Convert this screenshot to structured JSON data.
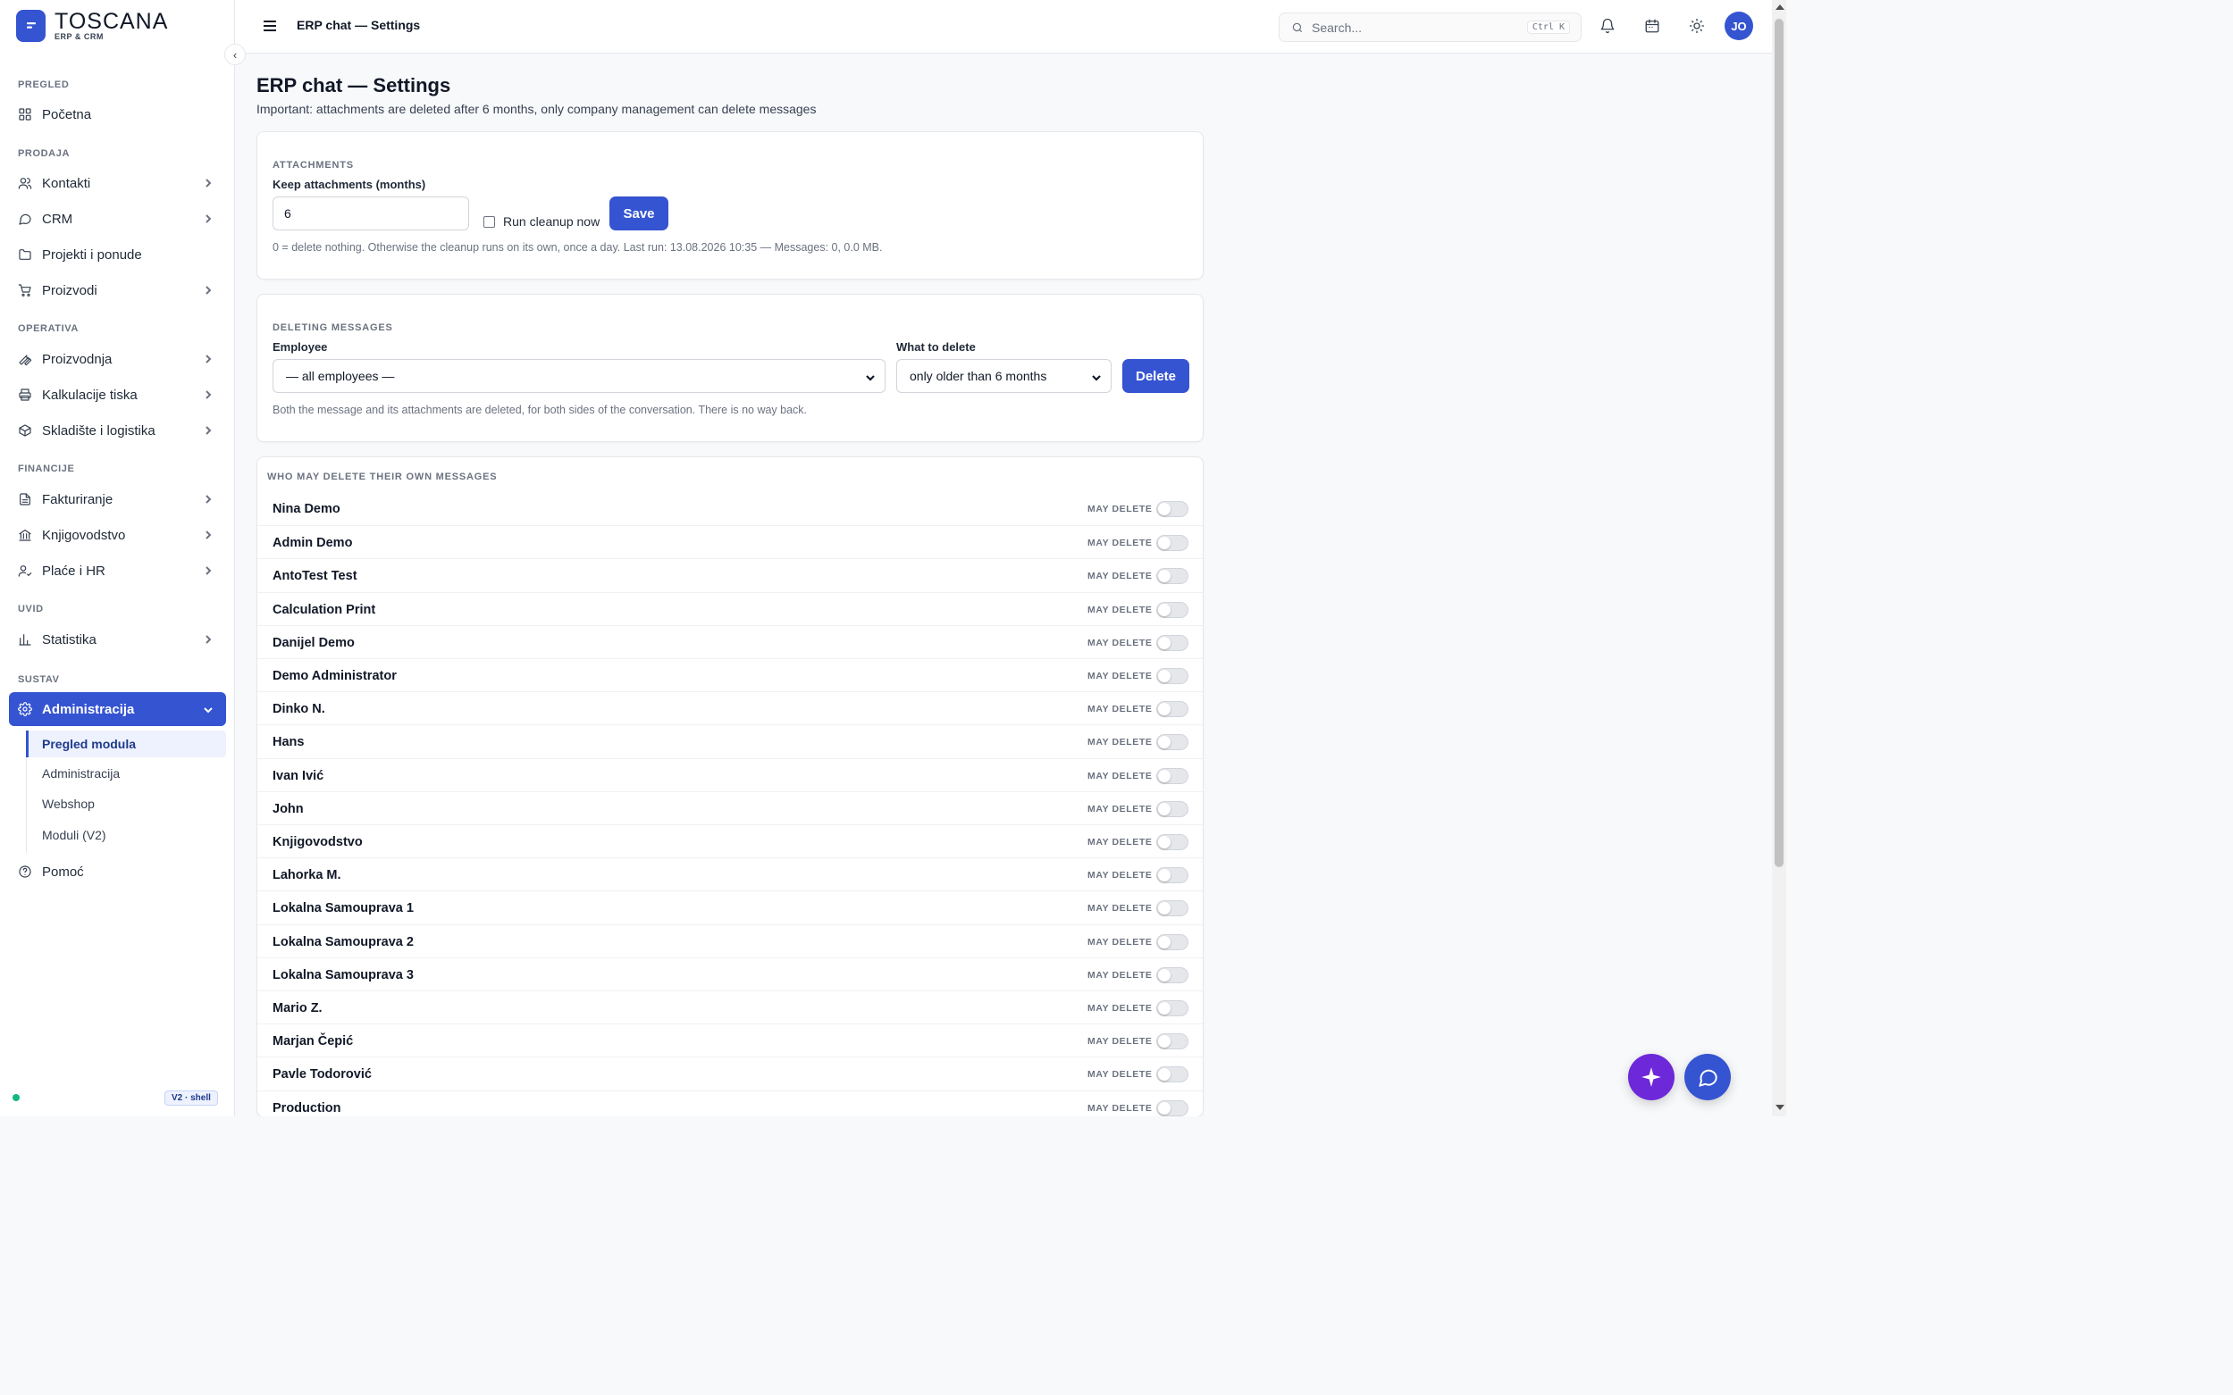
{
  "brand": {
    "name": "TOSCANA",
    "subtitle": "ERP & CRM"
  },
  "sidebar": {
    "sections": [
      {
        "label": "PREGLED"
      },
      {
        "label": "PRODAJA"
      },
      {
        "label": "OPERATIVA"
      },
      {
        "label": "FINANCIJE"
      },
      {
        "label": "UVID"
      },
      {
        "label": "SUSTAV"
      }
    ],
    "items": [
      {
        "label": "Početna",
        "icon": "dashboard-icon"
      },
      {
        "label": "Kontakti",
        "icon": "users-icon"
      },
      {
        "label": "CRM",
        "icon": "chat-icon"
      },
      {
        "label": "Projekti i ponude",
        "icon": "folder-icon"
      },
      {
        "label": "Proizvodi",
        "icon": "cart-icon"
      },
      {
        "label": "Proizvodnja",
        "icon": "wrench-icon"
      },
      {
        "label": "Kalkulacije tiska",
        "icon": "printer-icon"
      },
      {
        "label": "Skladište i logistika",
        "icon": "box-icon"
      },
      {
        "label": "Fakturiranje",
        "icon": "invoice-icon"
      },
      {
        "label": "Knjigovodstvo",
        "icon": "bank-icon"
      },
      {
        "label": "Plaće i HR",
        "icon": "user-check-icon"
      },
      {
        "label": "Statistika",
        "icon": "bar-chart-icon"
      },
      {
        "label": "Administracija",
        "icon": "gear-icon"
      },
      {
        "label": "Pomoć",
        "icon": "help-icon"
      }
    ],
    "subitems": [
      {
        "label": "Pregled modula"
      },
      {
        "label": "Administracija"
      },
      {
        "label": "Webshop"
      },
      {
        "label": "Moduli (V2)"
      }
    ],
    "version_badge": "V2 · shell"
  },
  "topbar": {
    "breadcrumb": "ERP chat — Settings",
    "search_placeholder": "Search...",
    "search_shortcut": "Ctrl K",
    "avatar_initials": "JO"
  },
  "page": {
    "title": "ERP chat — Settings",
    "subtitle": "Important: attachments are deleted after 6 months, only company management can delete messages"
  },
  "attachments": {
    "heading": "ATTACHMENTS",
    "keep_label": "Keep attachments (months)",
    "keep_value": "6",
    "cleanup_label": "Run cleanup now",
    "save_label": "Save",
    "hint": "0 = delete nothing. Otherwise the cleanup runs on its own, once a day. Last run: 13.08.2026 10:35 — Messages: 0, 0.0 MB."
  },
  "deleting": {
    "heading": "DELETING MESSAGES",
    "employee_label": "Employee",
    "employee_value": "— all employees —",
    "what_label": "What to delete",
    "what_value": "only older than 6 months",
    "delete_label": "Delete",
    "hint": "Both the message and its attachments are deleted, for both sides of the conversation. There is no way back."
  },
  "permissions": {
    "heading": "WHO MAY DELETE THEIR OWN MESSAGES",
    "toggle_label": "MAY DELETE",
    "users": [
      {
        "name": "Nina Demo",
        "may_delete": false
      },
      {
        "name": "Admin Demo",
        "may_delete": false
      },
      {
        "name": "AntoTest Test",
        "may_delete": false
      },
      {
        "name": "Calculation Print",
        "may_delete": false
      },
      {
        "name": "Danijel Demo",
        "may_delete": false
      },
      {
        "name": "Demo Administrator",
        "may_delete": false
      },
      {
        "name": "Dinko N.",
        "may_delete": false
      },
      {
        "name": "Hans",
        "may_delete": false
      },
      {
        "name": "Ivan Ivić",
        "may_delete": false
      },
      {
        "name": "John",
        "may_delete": false
      },
      {
        "name": "Knjigovodstvo",
        "may_delete": false
      },
      {
        "name": "Lahorka M.",
        "may_delete": false
      },
      {
        "name": "Lokalna Samouprava 1",
        "may_delete": false
      },
      {
        "name": "Lokalna Samouprava 2",
        "may_delete": false
      },
      {
        "name": "Lokalna Samouprava 3",
        "may_delete": false
      },
      {
        "name": "Mario Z.",
        "may_delete": false
      },
      {
        "name": "Marjan Čepić",
        "may_delete": false
      },
      {
        "name": "Pavle Todorović",
        "may_delete": false
      },
      {
        "name": "Production",
        "may_delete": false
      }
    ]
  },
  "colors": {
    "accent": "#3554d1",
    "ai_button": "#6d28d9",
    "online": "#10b981"
  }
}
